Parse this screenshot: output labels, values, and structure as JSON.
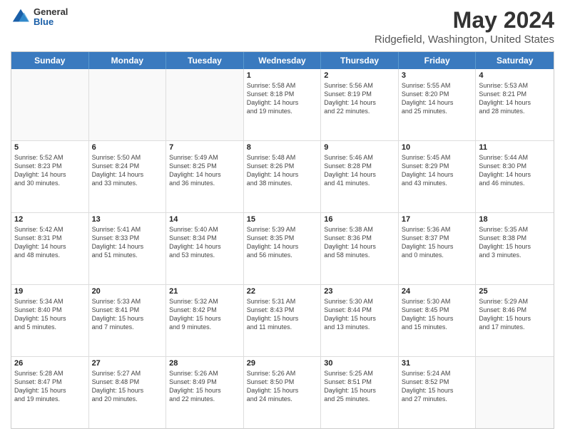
{
  "header": {
    "logo": {
      "general": "General",
      "blue": "Blue"
    },
    "title": "May 2024",
    "subtitle": "Ridgefield, Washington, United States"
  },
  "days": [
    "Sunday",
    "Monday",
    "Tuesday",
    "Wednesday",
    "Thursday",
    "Friday",
    "Saturday"
  ],
  "rows": [
    [
      {
        "day": "",
        "info": ""
      },
      {
        "day": "",
        "info": ""
      },
      {
        "day": "",
        "info": ""
      },
      {
        "day": "1",
        "info": "Sunrise: 5:58 AM\nSunset: 8:18 PM\nDaylight: 14 hours\nand 19 minutes."
      },
      {
        "day": "2",
        "info": "Sunrise: 5:56 AM\nSunset: 8:19 PM\nDaylight: 14 hours\nand 22 minutes."
      },
      {
        "day": "3",
        "info": "Sunrise: 5:55 AM\nSunset: 8:20 PM\nDaylight: 14 hours\nand 25 minutes."
      },
      {
        "day": "4",
        "info": "Sunrise: 5:53 AM\nSunset: 8:21 PM\nDaylight: 14 hours\nand 28 minutes."
      }
    ],
    [
      {
        "day": "5",
        "info": "Sunrise: 5:52 AM\nSunset: 8:23 PM\nDaylight: 14 hours\nand 30 minutes."
      },
      {
        "day": "6",
        "info": "Sunrise: 5:50 AM\nSunset: 8:24 PM\nDaylight: 14 hours\nand 33 minutes."
      },
      {
        "day": "7",
        "info": "Sunrise: 5:49 AM\nSunset: 8:25 PM\nDaylight: 14 hours\nand 36 minutes."
      },
      {
        "day": "8",
        "info": "Sunrise: 5:48 AM\nSunset: 8:26 PM\nDaylight: 14 hours\nand 38 minutes."
      },
      {
        "day": "9",
        "info": "Sunrise: 5:46 AM\nSunset: 8:28 PM\nDaylight: 14 hours\nand 41 minutes."
      },
      {
        "day": "10",
        "info": "Sunrise: 5:45 AM\nSunset: 8:29 PM\nDaylight: 14 hours\nand 43 minutes."
      },
      {
        "day": "11",
        "info": "Sunrise: 5:44 AM\nSunset: 8:30 PM\nDaylight: 14 hours\nand 46 minutes."
      }
    ],
    [
      {
        "day": "12",
        "info": "Sunrise: 5:42 AM\nSunset: 8:31 PM\nDaylight: 14 hours\nand 48 minutes."
      },
      {
        "day": "13",
        "info": "Sunrise: 5:41 AM\nSunset: 8:33 PM\nDaylight: 14 hours\nand 51 minutes."
      },
      {
        "day": "14",
        "info": "Sunrise: 5:40 AM\nSunset: 8:34 PM\nDaylight: 14 hours\nand 53 minutes."
      },
      {
        "day": "15",
        "info": "Sunrise: 5:39 AM\nSunset: 8:35 PM\nDaylight: 14 hours\nand 56 minutes."
      },
      {
        "day": "16",
        "info": "Sunrise: 5:38 AM\nSunset: 8:36 PM\nDaylight: 14 hours\nand 58 minutes."
      },
      {
        "day": "17",
        "info": "Sunrise: 5:36 AM\nSunset: 8:37 PM\nDaylight: 15 hours\nand 0 minutes."
      },
      {
        "day": "18",
        "info": "Sunrise: 5:35 AM\nSunset: 8:38 PM\nDaylight: 15 hours\nand 3 minutes."
      }
    ],
    [
      {
        "day": "19",
        "info": "Sunrise: 5:34 AM\nSunset: 8:40 PM\nDaylight: 15 hours\nand 5 minutes."
      },
      {
        "day": "20",
        "info": "Sunrise: 5:33 AM\nSunset: 8:41 PM\nDaylight: 15 hours\nand 7 minutes."
      },
      {
        "day": "21",
        "info": "Sunrise: 5:32 AM\nSunset: 8:42 PM\nDaylight: 15 hours\nand 9 minutes."
      },
      {
        "day": "22",
        "info": "Sunrise: 5:31 AM\nSunset: 8:43 PM\nDaylight: 15 hours\nand 11 minutes."
      },
      {
        "day": "23",
        "info": "Sunrise: 5:30 AM\nSunset: 8:44 PM\nDaylight: 15 hours\nand 13 minutes."
      },
      {
        "day": "24",
        "info": "Sunrise: 5:30 AM\nSunset: 8:45 PM\nDaylight: 15 hours\nand 15 minutes."
      },
      {
        "day": "25",
        "info": "Sunrise: 5:29 AM\nSunset: 8:46 PM\nDaylight: 15 hours\nand 17 minutes."
      }
    ],
    [
      {
        "day": "26",
        "info": "Sunrise: 5:28 AM\nSunset: 8:47 PM\nDaylight: 15 hours\nand 19 minutes."
      },
      {
        "day": "27",
        "info": "Sunrise: 5:27 AM\nSunset: 8:48 PM\nDaylight: 15 hours\nand 20 minutes."
      },
      {
        "day": "28",
        "info": "Sunrise: 5:26 AM\nSunset: 8:49 PM\nDaylight: 15 hours\nand 22 minutes."
      },
      {
        "day": "29",
        "info": "Sunrise: 5:26 AM\nSunset: 8:50 PM\nDaylight: 15 hours\nand 24 minutes."
      },
      {
        "day": "30",
        "info": "Sunrise: 5:25 AM\nSunset: 8:51 PM\nDaylight: 15 hours\nand 25 minutes."
      },
      {
        "day": "31",
        "info": "Sunrise: 5:24 AM\nSunset: 8:52 PM\nDaylight: 15 hours\nand 27 minutes."
      },
      {
        "day": "",
        "info": ""
      }
    ]
  ]
}
